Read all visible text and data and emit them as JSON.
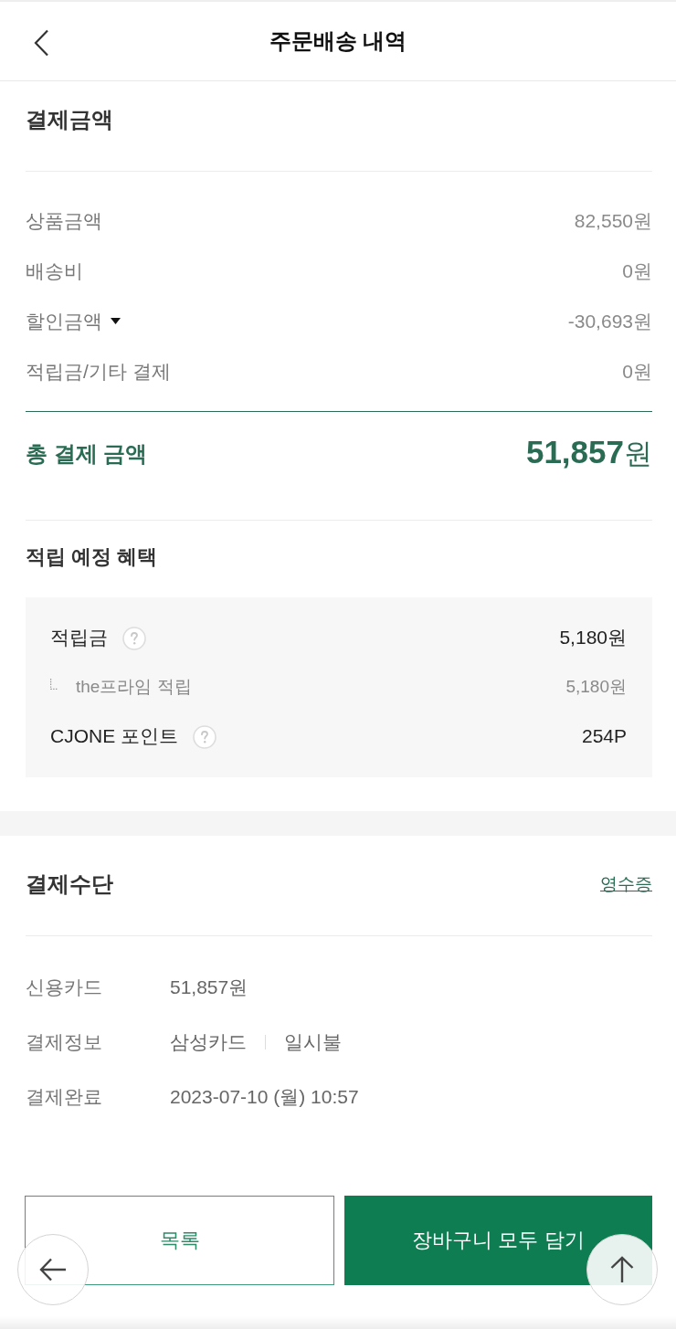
{
  "header": {
    "title": "주문배송 내역"
  },
  "payment_amount": {
    "title": "결제금액",
    "rows": [
      {
        "kind": "plain",
        "label": "상품금액",
        "value": "82,550원"
      },
      {
        "kind": "plain",
        "label": "배송비",
        "value": "0원"
      },
      {
        "kind": "toggle",
        "label": "할인금액",
        "value": "-30,693원",
        "expanded": false
      },
      {
        "kind": "plain",
        "label": "적립금/기타 결제",
        "value": "0원"
      }
    ],
    "total": {
      "label": "총 결제 금액",
      "amount": "51,857",
      "unit": "원"
    }
  },
  "benefits": {
    "title": "적립 예정 혜택",
    "items": [
      {
        "label": "적립금",
        "value": "5,180원",
        "help": true,
        "children": [
          {
            "label": "the프라임 적립",
            "value": "5,180원"
          }
        ]
      },
      {
        "label": "CJONE 포인트",
        "value": "254P",
        "help": true
      }
    ]
  },
  "payment_method": {
    "title": "결제수단",
    "receipt_link": "영수증",
    "rows": [
      {
        "label": "신용카드",
        "values": [
          "51,857원"
        ]
      },
      {
        "label": "결제정보",
        "values": [
          "삼성카드",
          "일시불"
        ]
      },
      {
        "label": "결제완료",
        "values": [
          "2023-07-10 (월) 10:57"
        ]
      }
    ]
  },
  "buttons": [
    {
      "kind": "outline",
      "label": "목록"
    },
    {
      "kind": "primary",
      "label": "장바구니 모두 담기"
    }
  ]
}
